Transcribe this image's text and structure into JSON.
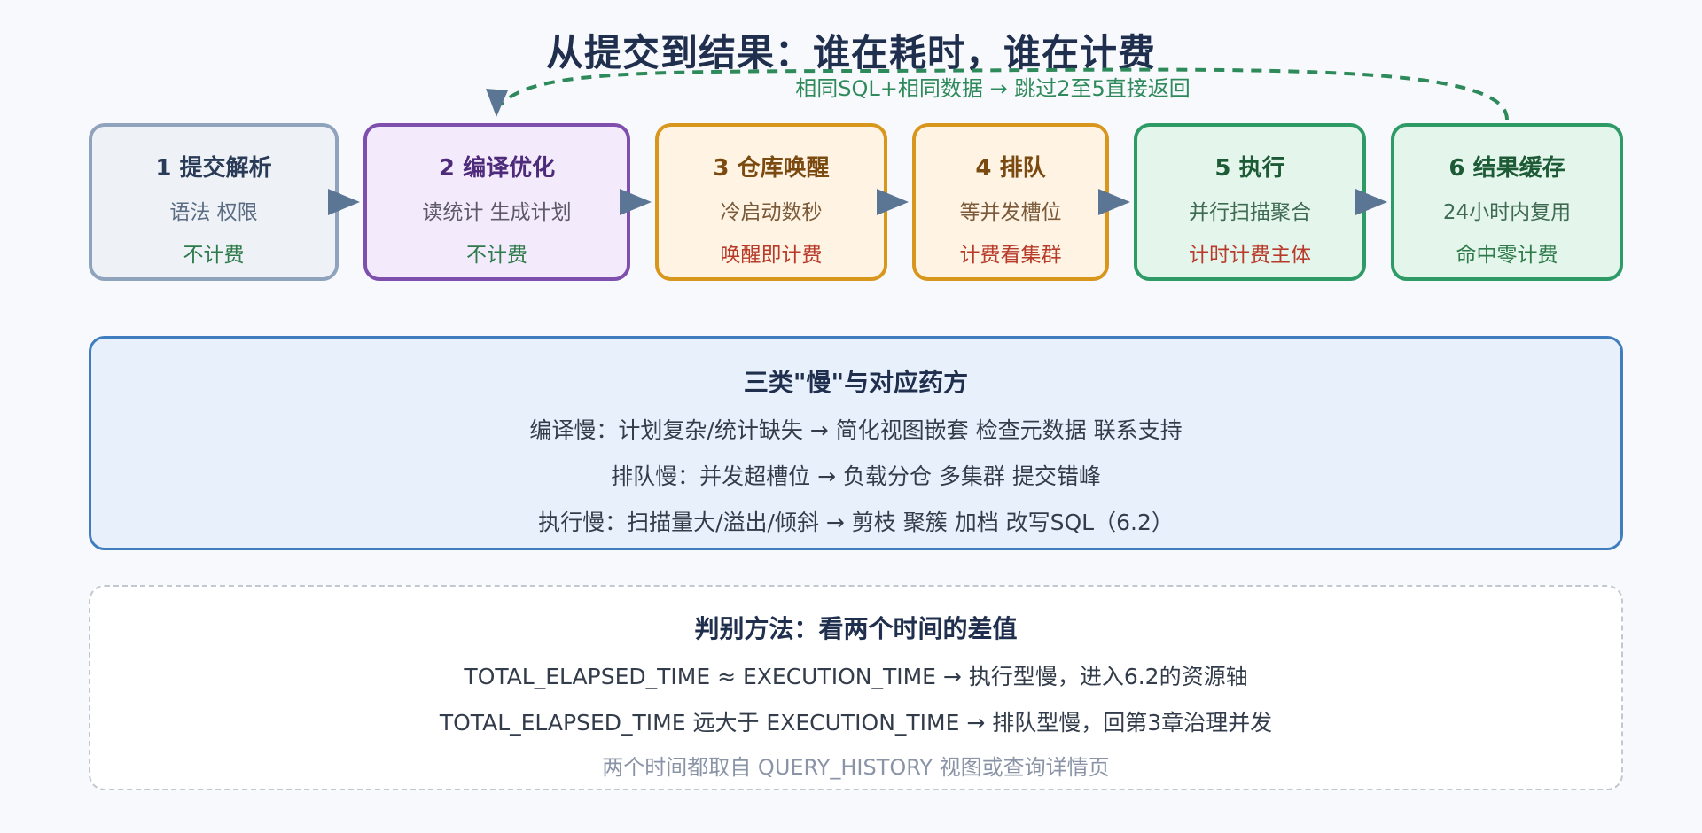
{
  "title": "从提交到结果：谁在耗时，谁在计费",
  "loop_label": "相同SQL+相同数据 → 跳过2至5直接返回",
  "stages": [
    {
      "heading": "1 提交解析",
      "desc": "语法 权限",
      "cost": "不计费"
    },
    {
      "heading": "2 编译优化",
      "desc": "读统计 生成计划",
      "cost": "不计费"
    },
    {
      "heading": "3 仓库唤醒",
      "desc": "冷启动数秒",
      "cost": "唤醒即计费"
    },
    {
      "heading": "4 排队",
      "desc": "等并发槽位",
      "cost": "计费看集群"
    },
    {
      "heading": "5 执行",
      "desc": "并行扫描聚合",
      "cost": "计时计费主体"
    },
    {
      "heading": "6 结果缓存",
      "desc": "24小时内复用",
      "cost": "命中零计费"
    }
  ],
  "slowness": {
    "heading": "三类\"慢\"与对应药方",
    "rows": [
      "编译慢：计划复杂/统计缺失 → 简化视图嵌套 检查元数据 联系支持",
      "排队慢：并发超槽位 → 负载分仓 多集群 提交错峰",
      "执行慢：扫描量大/溢出/倾斜 → 剪枝 聚簇 加档 改写SQL（6.2）"
    ]
  },
  "judgement": {
    "heading": "判别方法：看两个时间的差值",
    "rows": [
      "TOTAL_ELAPSED_TIME ≈ EXECUTION_TIME → 执行型慢，进入6.2的资源轴",
      "TOTAL_ELAPSED_TIME 远大于 EXECUTION_TIME → 排队型慢，回第3章治理并发"
    ],
    "footnote": "两个时间都取自 QUERY_HISTORY 视图或查询详情页"
  },
  "colors": {
    "arrow": "#5b7594",
    "loop": "#2e8a5a",
    "free": "#2e7a4a",
    "charged": "#b83a2a"
  }
}
